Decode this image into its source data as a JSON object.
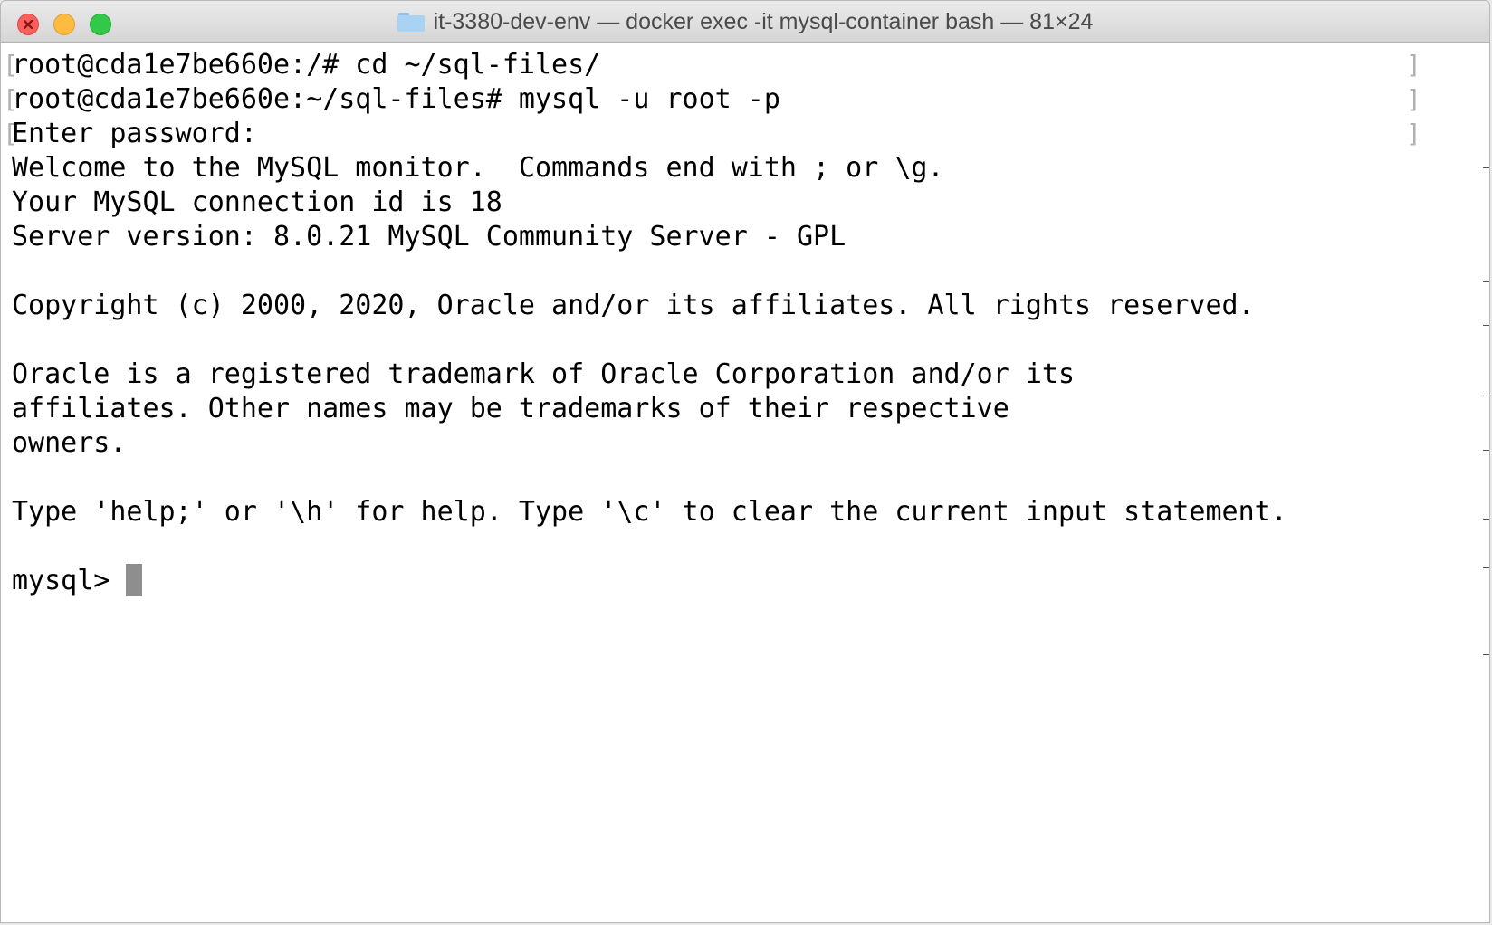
{
  "window": {
    "title": "it-3380-dev-env — docker exec -it mysql-container bash — 81×24",
    "icon": "folder-icon"
  },
  "titlebar_buttons": {
    "close": "close-button",
    "minimize": "minimize-button",
    "zoom": "zoom-button"
  },
  "terminal": {
    "lines": [
      "root@cda1e7be660e:/# cd ~/sql-files/",
      "root@cda1e7be660e:~/sql-files# mysql -u root -p",
      "Enter password:",
      "Welcome to the MySQL monitor.  Commands end with ; or \\g.",
      "Your MySQL connection id is 18",
      "Server version: 8.0.21 MySQL Community Server - GPL",
      "",
      "Copyright (c) 2000, 2020, Oracle and/or its affiliates. All rights reserved.",
      "",
      "Oracle is a registered trademark of Oracle Corporation and/or its",
      "affiliates. Other names may be trademarks of their respective",
      "owners.",
      "",
      "Type 'help;' or '\\h' for help. Type '\\c' to clear the current input statement.",
      ""
    ],
    "prompt": "mysql> "
  }
}
